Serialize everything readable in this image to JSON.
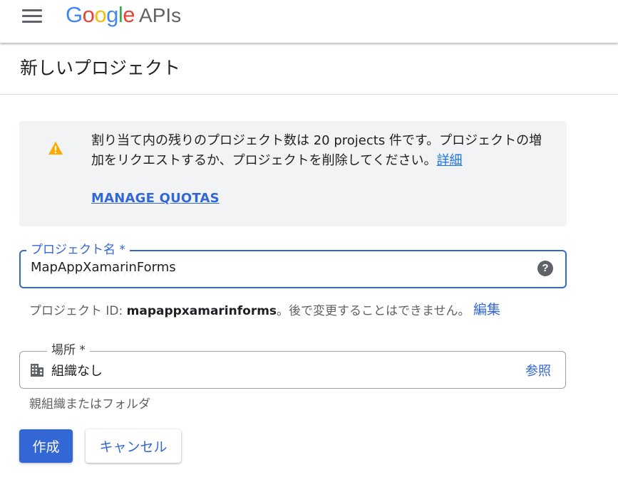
{
  "header": {
    "logo": {
      "G": "G",
      "o1": "o",
      "o2": "o",
      "g": "g",
      "l": "l",
      "e": "e"
    },
    "logo_suffix": "APIs"
  },
  "page": {
    "title": "新しいプロジェクト"
  },
  "warning": {
    "text": "割り当て内の残りのプロジェクト数は 20 projects 件です。プロジェクトの増加をリクエストするか、プロジェクトを削除してください。",
    "details_link": "詳細",
    "manage_quotas": "MANAGE QUOTAS"
  },
  "project_name": {
    "label": "プロジェクト名 *",
    "value": "MapAppXamarinForms",
    "help": "?"
  },
  "project_id": {
    "prefix": "プロジェクト ID: ",
    "id": "mapappxamarinforms",
    "suffix": "。後で変更することはできません。",
    "edit": "編集"
  },
  "location": {
    "label": "場所 *",
    "value": "組織なし",
    "browse": "参照",
    "hint": "親組織またはフォルダ"
  },
  "buttons": {
    "create": "作成",
    "cancel": "キャンセル"
  },
  "colors": {
    "accent": "#3367d6",
    "warning_icon": "#f9ab00",
    "panel_bg": "#f1f3f4"
  }
}
